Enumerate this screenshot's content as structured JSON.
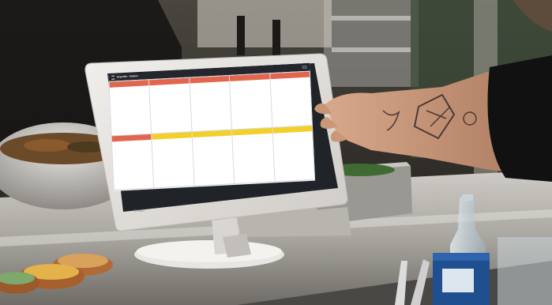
{
  "scene": {
    "description_colors": {
      "background_kitchen": "#3a3630",
      "counter_steel": "#b9b7b2",
      "tablet_bezel": "#e4e1dd",
      "screen_header": "#23262c",
      "ticket_red": "#e2664e",
      "ticket_yellow": "#f2cf2a",
      "skin": "#c89a7c",
      "sleeve": "#111111"
    }
  },
  "kds": {
    "station_label": "Expedite - Station",
    "clock_label": "",
    "action_label": "",
    "tiles": [
      {
        "tickets": [
          {
            "color": "red",
            "title": "",
            "items": [
              "",
              "",
              ""
            ]
          },
          {
            "color": "red",
            "title": "",
            "items": [
              "",
              "",
              "",
              ""
            ]
          }
        ]
      },
      {
        "tickets": [
          {
            "color": "red",
            "title": "",
            "items": [
              "",
              ""
            ]
          },
          {
            "color": "yellow",
            "title": "",
            "items": [
              "",
              ""
            ]
          }
        ]
      },
      {
        "tickets": [
          {
            "color": "red",
            "title": "",
            "items": [
              "",
              "",
              ""
            ]
          },
          {
            "color": "yellow",
            "title": "",
            "items": [
              "",
              "",
              "",
              ""
            ]
          }
        ]
      },
      {
        "tickets": [
          {
            "color": "red",
            "title": "",
            "items": [
              "",
              "",
              ""
            ]
          },
          {
            "color": "yellow",
            "title": "",
            "items": [
              "",
              "",
              ""
            ]
          }
        ]
      },
      {
        "tickets": [
          {
            "color": "red",
            "title": "",
            "items": [
              ""
            ]
          },
          {
            "color": "yellow",
            "title": "",
            "items": [
              "",
              ""
            ]
          }
        ]
      }
    ]
  },
  "device": {
    "logo_text": "Fresh"
  }
}
